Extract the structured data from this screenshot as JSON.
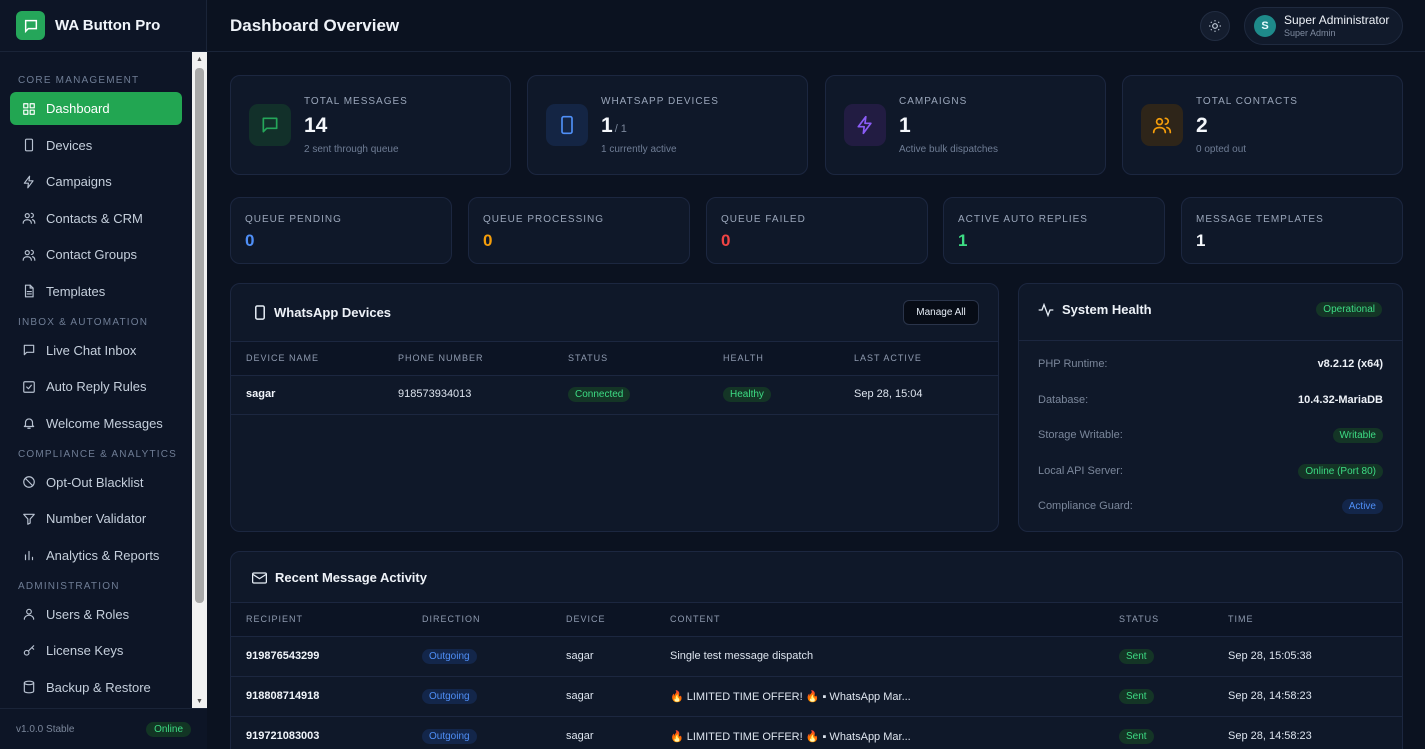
{
  "app": {
    "name": "WA Button Pro",
    "version": "v1.0.0 Stable",
    "status": "Online"
  },
  "header": {
    "title": "Dashboard Overview",
    "user_name": "Super Administrator",
    "user_role": "Super Admin",
    "avatar_initial": "S"
  },
  "sidebar": {
    "sections": [
      {
        "title": "CORE MANAGEMENT",
        "items": [
          {
            "label": "Dashboard",
            "icon": "grid-icon",
            "active": true
          },
          {
            "label": "Devices",
            "icon": "phone-icon"
          },
          {
            "label": "Campaigns",
            "icon": "lightning-icon"
          },
          {
            "label": "Contacts & CRM",
            "icon": "users-icon"
          },
          {
            "label": "Contact Groups",
            "icon": "users-icon"
          },
          {
            "label": "Templates",
            "icon": "file-icon"
          }
        ]
      },
      {
        "title": "INBOX & AUTOMATION",
        "items": [
          {
            "label": "Live Chat Inbox",
            "icon": "chat-icon"
          },
          {
            "label": "Auto Reply Rules",
            "icon": "check-square-icon"
          },
          {
            "label": "Welcome Messages",
            "icon": "bell-icon"
          }
        ]
      },
      {
        "title": "COMPLIANCE & ANALYTICS",
        "items": [
          {
            "label": "Opt-Out Blacklist",
            "icon": "ban-icon"
          },
          {
            "label": "Number Validator",
            "icon": "filter-icon"
          },
          {
            "label": "Analytics & Reports",
            "icon": "bar-chart-icon"
          }
        ]
      },
      {
        "title": "ADMINISTRATION",
        "items": [
          {
            "label": "Users & Roles",
            "icon": "user-icon"
          },
          {
            "label": "License Keys",
            "icon": "key-icon"
          },
          {
            "label": "Backup & Restore",
            "icon": "database-icon"
          }
        ]
      }
    ]
  },
  "stats": [
    {
      "label": "TOTAL MESSAGES",
      "value": "14",
      "suffix": "",
      "desc": "2 sent through queue",
      "icon": "chat-icon",
      "color": "#25a65a",
      "bg": "#12302a"
    },
    {
      "label": "WHATSAPP DEVICES",
      "value": "1",
      "suffix": "/ 1",
      "desc": "1 currently active",
      "icon": "phone-icon",
      "color": "#4f8ff7",
      "bg": "#142544"
    },
    {
      "label": "CAMPAIGNS",
      "value": "1",
      "suffix": "",
      "desc": "Active bulk dispatches",
      "icon": "lightning-icon",
      "color": "#8b5cf6",
      "bg": "#221c42"
    },
    {
      "label": "TOTAL CONTACTS",
      "value": "2",
      "suffix": "",
      "desc": "0 opted out",
      "icon": "users-icon",
      "color": "#f59e0b",
      "bg": "#2e2519"
    }
  ],
  "queue": [
    {
      "label": "QUEUE PENDING",
      "value": "0",
      "color": "#4f8ff7"
    },
    {
      "label": "QUEUE PROCESSING",
      "value": "0",
      "color": "#f59e0b"
    },
    {
      "label": "QUEUE FAILED",
      "value": "0",
      "color": "#ef4444"
    },
    {
      "label": "ACTIVE AUTO REPLIES",
      "value": "1",
      "color": "#3ddc84"
    },
    {
      "label": "MESSAGE TEMPLATES",
      "value": "1",
      "color": "#f4f7fb"
    }
  ],
  "devices_panel": {
    "title": "WhatsApp Devices",
    "manage_label": "Manage All",
    "columns": [
      "DEVICE NAME",
      "PHONE NUMBER",
      "STATUS",
      "HEALTH",
      "LAST ACTIVE"
    ],
    "rows": [
      {
        "name": "sagar",
        "phone": "918573934013",
        "status": "Connected",
        "health": "Healthy",
        "last_active": "Sep 28, 15:04"
      }
    ]
  },
  "health_panel": {
    "title": "System Health",
    "status": "Operational",
    "rows": [
      {
        "label": "PHP Runtime:",
        "value": "v8.2.12 (x64)",
        "type": "text"
      },
      {
        "label": "Database:",
        "value": "10.4.32-MariaDB",
        "type": "text"
      },
      {
        "label": "Storage Writable:",
        "value": "Writable",
        "type": "green"
      },
      {
        "label": "Local API Server:",
        "value": "Online (Port 80)",
        "type": "green"
      },
      {
        "label": "Compliance Guard:",
        "value": "Active",
        "type": "blue"
      }
    ]
  },
  "activity_panel": {
    "title": "Recent Message Activity",
    "columns": [
      "RECIPIENT",
      "DIRECTION",
      "DEVICE",
      "CONTENT",
      "STATUS",
      "TIME"
    ],
    "rows": [
      {
        "recipient": "919876543299",
        "direction": "Outgoing",
        "device": "sagar",
        "content": "Single test message dispatch",
        "status": "Sent",
        "time": "Sep 28, 15:05:38"
      },
      {
        "recipient": "918808714918",
        "direction": "Outgoing",
        "device": "sagar",
        "content": "🔥 LIMITED TIME OFFER! 🔥 ▪ WhatsApp Mar...",
        "status": "Sent",
        "time": "Sep 28, 14:58:23"
      },
      {
        "recipient": "919721083003",
        "direction": "Outgoing",
        "device": "sagar",
        "content": "🔥 LIMITED TIME OFFER! 🔥 ▪ WhatsApp Mar...",
        "status": "Sent",
        "time": "Sep 28, 14:58:23"
      }
    ]
  }
}
